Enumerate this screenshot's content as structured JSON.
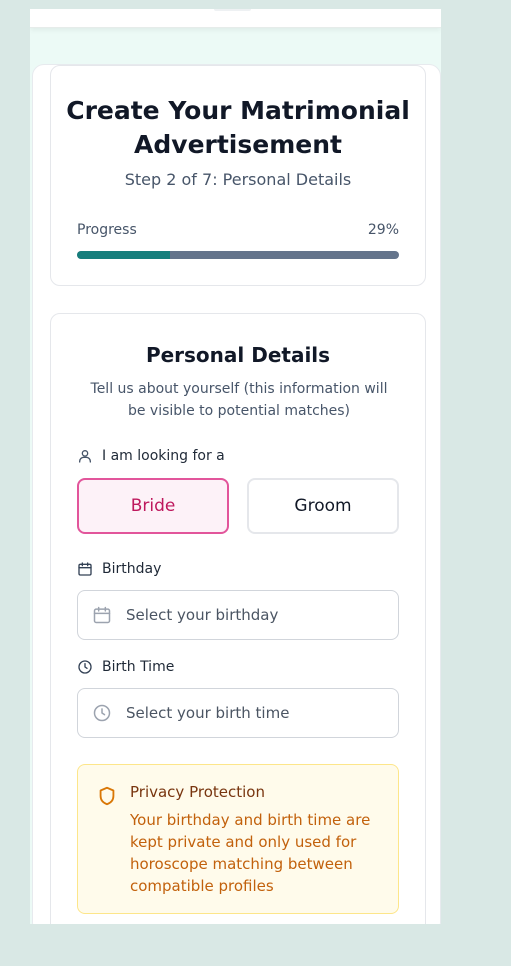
{
  "header": {
    "title": "Create Your Matrimonial Advertisement",
    "step": "Step 2 of 7: Personal Details",
    "progress_label": "Progress",
    "progress_text": "29%",
    "progress_fraction": 0.29
  },
  "section": {
    "title": "Personal Details",
    "description": "Tell us about yourself (this information will be visible to potential matches)"
  },
  "looking_for": {
    "label": "I am looking for a",
    "options": [
      "Bride",
      "Groom"
    ],
    "selected": "Bride"
  },
  "birthday": {
    "label": "Birthday",
    "placeholder": "Select your birthday"
  },
  "birth_time": {
    "label": "Birth Time",
    "placeholder": "Select your birth time"
  },
  "privacy": {
    "title": "Privacy Protection",
    "text": "Your birthday and birth time are kept private and only used for horoscope matching between compatible profiles"
  },
  "colors": {
    "accent": "#167e7c",
    "selected_border": "#e2559b",
    "notice_bg": "#fffbeb"
  },
  "icons": [
    "user-icon",
    "calendar-icon",
    "clock-icon",
    "shield-icon"
  ]
}
